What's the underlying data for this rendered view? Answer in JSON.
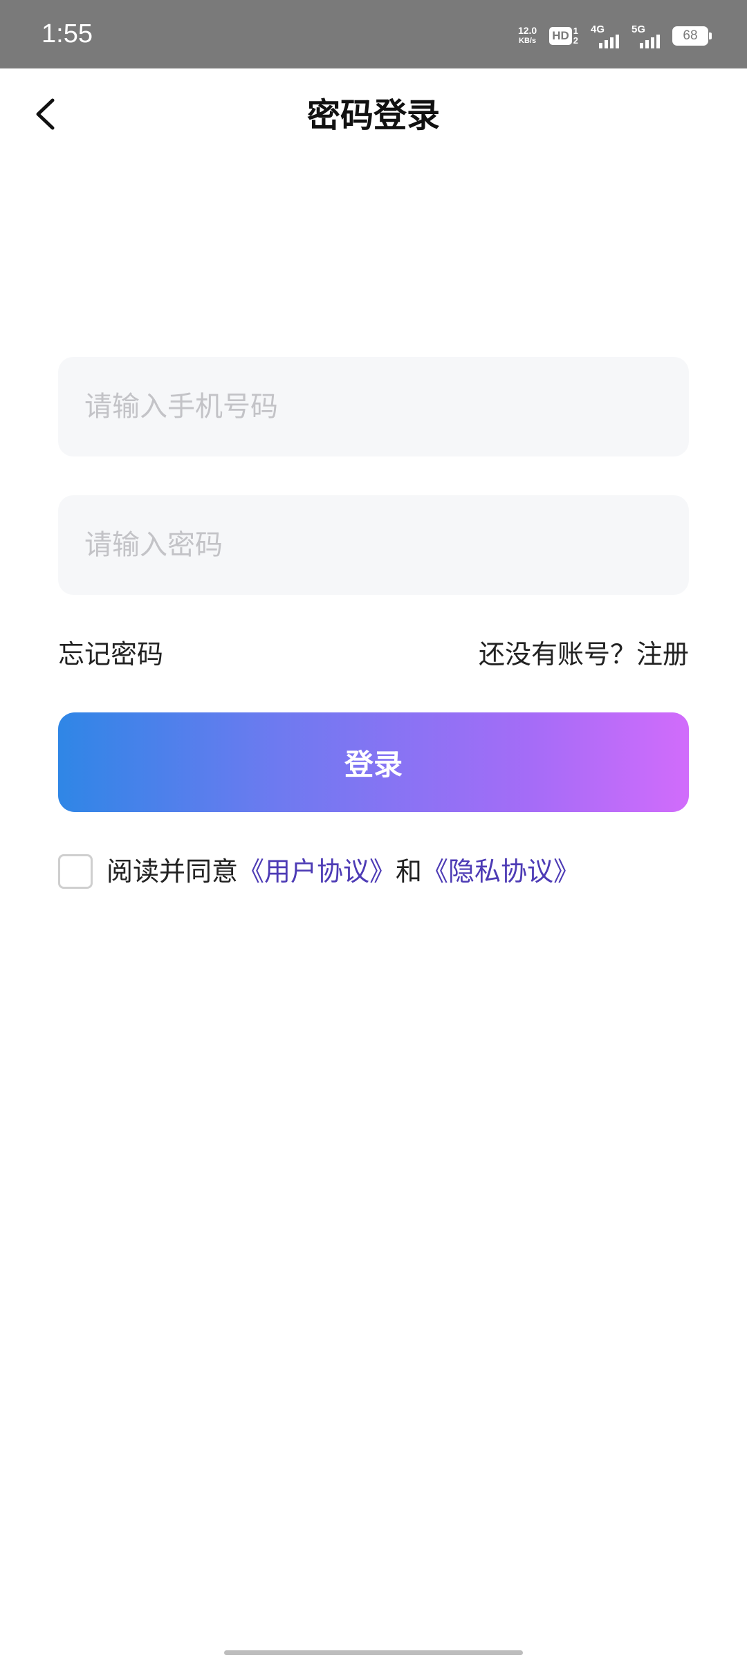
{
  "status_bar": {
    "time": "1:55",
    "net_speed_value": "12.0",
    "net_speed_unit": "KB/s",
    "hd_label": "HD",
    "hd_num_top": "1",
    "hd_num_bottom": "2",
    "sig1_label": "4G",
    "sig2_label": "5G",
    "battery": "68"
  },
  "header": {
    "title": "密码登录"
  },
  "form": {
    "phone_placeholder": "请输入手机号码",
    "password_placeholder": "请输入密码",
    "forgot_password": "忘记密码",
    "register": "还没有账号？注册",
    "login_button": "登录"
  },
  "agreement": {
    "prefix": "阅读并同意",
    "user_agreement": "《用户协议》",
    "and": "和",
    "privacy_policy": "《隐私协议》"
  },
  "colors": {
    "status_bar_bg": "#7a7a7a",
    "gradient_start": "#2f86e6",
    "gradient_end": "#d16cfb",
    "link_color": "#4d3bb5",
    "input_bg": "#f6f7f9"
  }
}
